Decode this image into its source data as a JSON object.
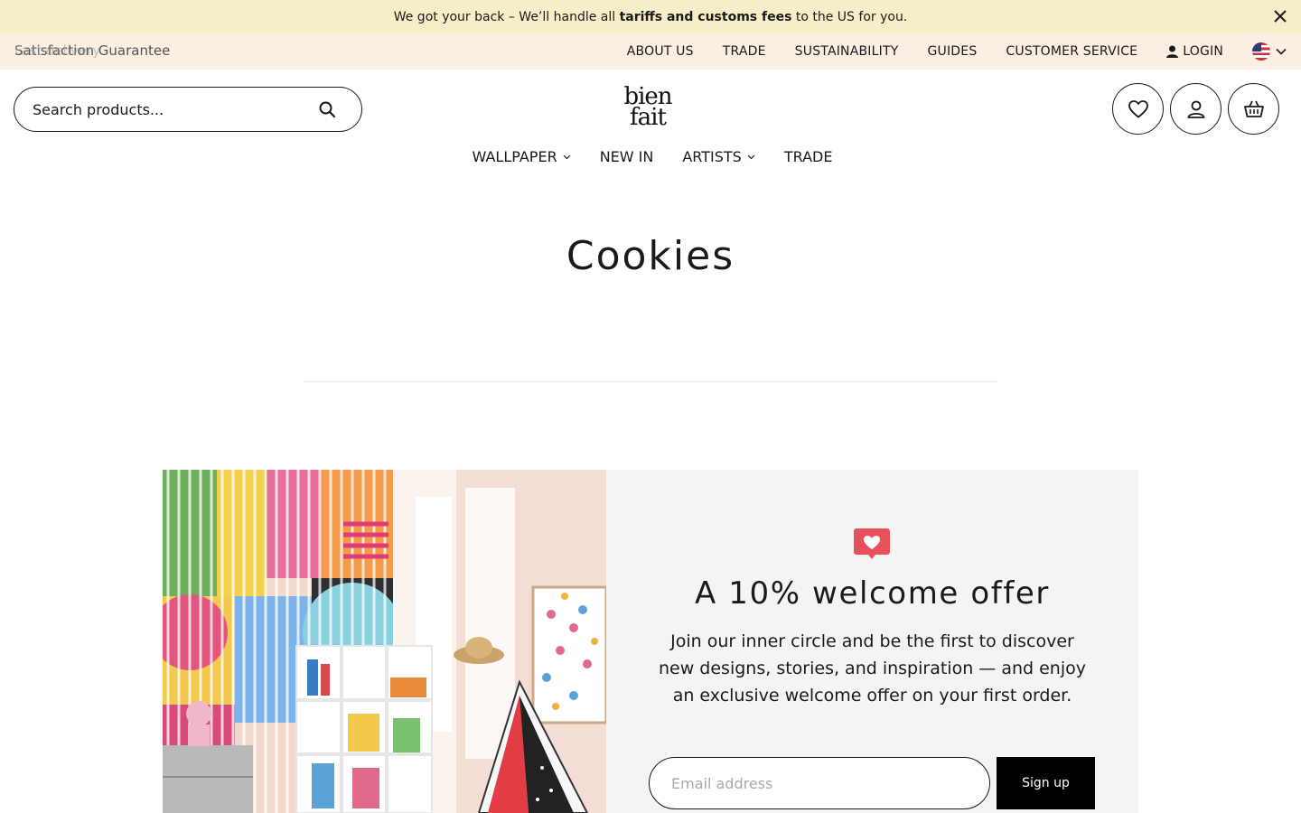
{
  "announcement": {
    "prefix": "We got your back – We’ll handle all ",
    "bold": "tariffs and customs fees",
    "suffix": " to the US for you."
  },
  "utility": {
    "ticker_text": "Satisfaction Guarantee",
    "ticker_ghost": "Fast delivery",
    "nav": [
      "ABOUT US",
      "TRADE",
      "SUSTAINABILITY",
      "GUIDES",
      "CUSTOMER SERVICE"
    ],
    "login_label": "LOGIN"
  },
  "search": {
    "placeholder": "Search products..."
  },
  "logo": {
    "line1": "bien",
    "line2": "fait"
  },
  "main_nav": [
    {
      "label": "WALLPAPER",
      "has_dropdown": true
    },
    {
      "label": "NEW IN",
      "has_dropdown": false
    },
    {
      "label": "ARTISTS",
      "has_dropdown": true
    },
    {
      "label": "TRADE",
      "has_dropdown": false
    }
  ],
  "page": {
    "title": "Cookies"
  },
  "promo": {
    "heading": "A 10% welcome offer",
    "body": "Join our inner circle and be the first to discover new designs, stories, and inspiration — and enjoy an exclusive welcome offer on your first order.",
    "email_placeholder": "Email address",
    "signup_label": "Sign up"
  },
  "colors": {
    "announcement_bg": "#f4efc6",
    "utility_bg": "#fbeee3",
    "badge": "#e8505b",
    "panel_bg": "#f4f4f4"
  }
}
